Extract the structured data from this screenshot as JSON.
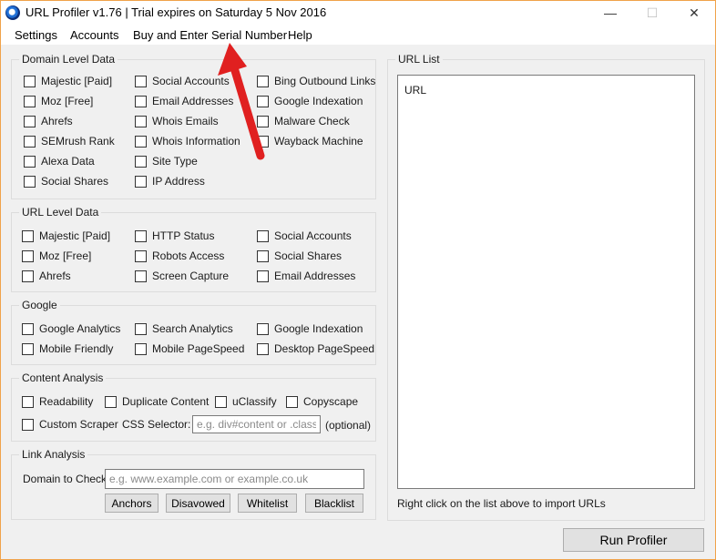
{
  "window": {
    "title": "URL Profiler v1.76 | Trial expires on Saturday 5 Nov 2016",
    "minimize": "—",
    "maximize": "☐",
    "close": "✕"
  },
  "menu": [
    "Settings",
    "Accounts",
    "Buy and Enter Serial Number",
    "Help"
  ],
  "domain_level": {
    "title": "Domain Level Data",
    "items": [
      "Majestic [Paid]",
      "Social Accounts",
      "Bing Outbound Links",
      "Moz [Free]",
      "Email Addresses",
      "Google Indexation",
      "Ahrefs",
      "Whois Emails",
      "Malware Check",
      "SEMrush Rank",
      "Whois Information",
      "Wayback Machine",
      "Alexa Data",
      "Site Type",
      "Social Shares",
      "IP Address"
    ]
  },
  "url_level": {
    "title": "URL Level Data",
    "items": [
      "Majestic [Paid]",
      "HTTP Status",
      "Social Accounts",
      "Moz [Free]",
      "Robots Access",
      "Social Shares",
      "Ahrefs",
      "Screen Capture",
      "Email Addresses"
    ]
  },
  "google": {
    "title": "Google",
    "items": [
      "Google Analytics",
      "Search Analytics",
      "Google Indexation",
      "Mobile Friendly",
      "Mobile PageSpeed",
      "Desktop PageSpeed"
    ]
  },
  "content_analysis": {
    "title": "Content Analysis",
    "items": [
      "Readability",
      "Duplicate Content",
      "uClassify",
      "Copyscape",
      "Custom Scraper"
    ],
    "css_selector_label": "CSS Selector:",
    "css_selector_placeholder": "e.g. div#content or .class-na",
    "optional": "(optional)"
  },
  "link_analysis": {
    "title": "Link Analysis",
    "domain_label": "Domain to Check:",
    "domain_placeholder": "e.g. www.example.com or example.co.uk",
    "buttons": [
      "Anchors",
      "Disavowed",
      "Whitelist",
      "Blacklist"
    ]
  },
  "url_list": {
    "title": "URL List",
    "header": "URL",
    "hint": "Right click on the list above to import URLs"
  },
  "run_button": "Run Profiler",
  "annotation": {
    "color": "#e02020"
  }
}
